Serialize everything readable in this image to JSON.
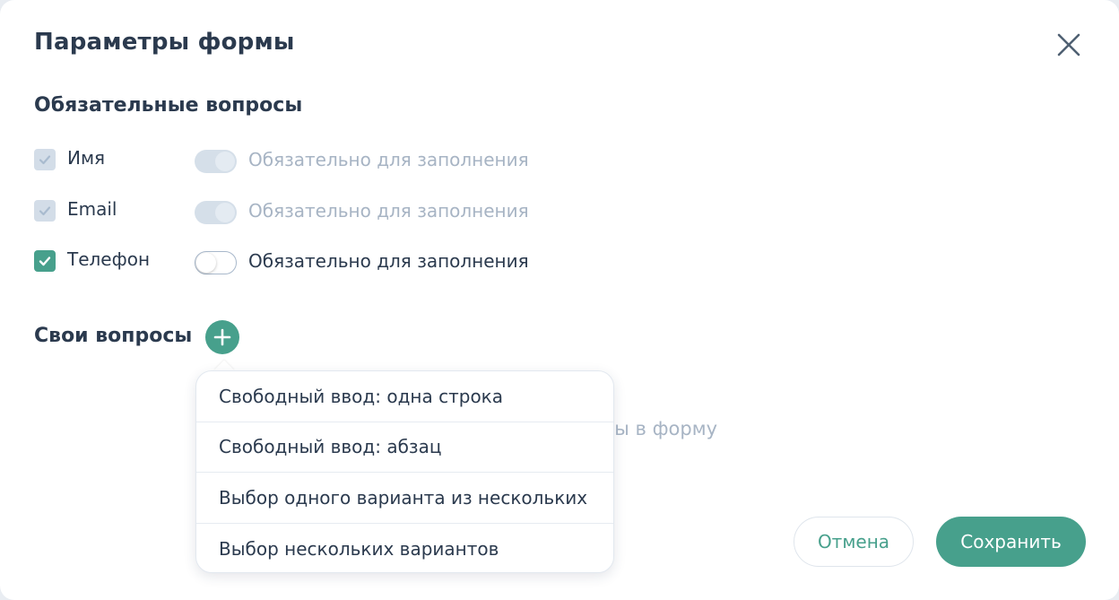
{
  "dialog": {
    "title": "Параметры формы",
    "close_icon": "close-icon"
  },
  "required_section": {
    "title": "Обязательные вопросы",
    "items": [
      {
        "label": "Имя",
        "checked": true,
        "checkbox_disabled": true,
        "toggle_label": "Обязательно для заполнения",
        "toggle_on": true,
        "toggle_disabled": true
      },
      {
        "label": "Email",
        "checked": true,
        "checkbox_disabled": true,
        "toggle_label": "Обязательно для заполнения",
        "toggle_on": true,
        "toggle_disabled": true
      },
      {
        "label": "Телефон",
        "checked": true,
        "checkbox_disabled": false,
        "toggle_label": "Обязательно для заполнения",
        "toggle_on": false,
        "toggle_disabled": false
      }
    ]
  },
  "custom_section": {
    "title": "Свои вопросы",
    "add_icon": "plus-icon",
    "empty_hint_visible": "ты в форму"
  },
  "add_menu": {
    "items": [
      "Свободный ввод: одна строка",
      "Свободный ввод: абзац",
      "Выбор одного варианта из нескольких",
      "Выбор нескольких вариантов"
    ]
  },
  "footer": {
    "cancel_label": "Отмена",
    "save_label": "Сохранить"
  },
  "colors": {
    "accent": "#47a08c",
    "text": "#2b3a4e",
    "muted": "#a7b4c4"
  }
}
